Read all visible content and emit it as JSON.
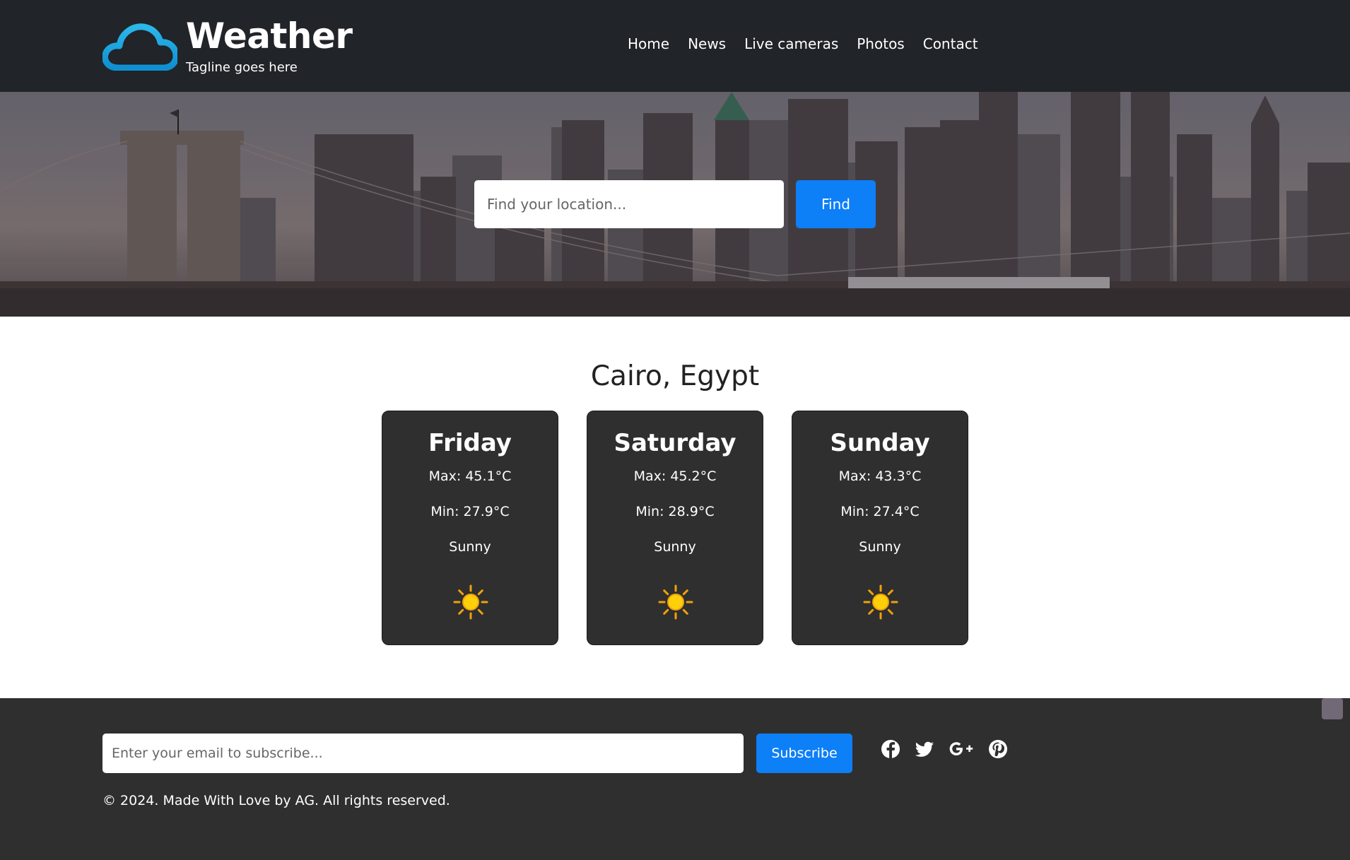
{
  "header": {
    "title": "Weather",
    "tagline": "Tagline goes here",
    "nav": [
      {
        "label": "Home"
      },
      {
        "label": "News"
      },
      {
        "label": "Live cameras"
      },
      {
        "label": "Photos"
      },
      {
        "label": "Contact"
      }
    ]
  },
  "hero": {
    "search_placeholder": "Find your location...",
    "find_label": "Find"
  },
  "forecast": {
    "location": "Cairo, Egypt",
    "days": [
      {
        "day": "Friday",
        "max": "Max: 45.1°C",
        "min": "Min: 27.9°C",
        "condition": "Sunny",
        "icon": "sun-icon"
      },
      {
        "day": "Saturday",
        "max": "Max: 45.2°C",
        "min": "Min: 28.9°C",
        "condition": "Sunny",
        "icon": "sun-icon"
      },
      {
        "day": "Sunday",
        "max": "Max: 43.3°C",
        "min": "Min: 27.4°C",
        "condition": "Sunny",
        "icon": "sun-icon"
      }
    ]
  },
  "footer": {
    "email_placeholder": "Enter your email to subscribe...",
    "subscribe_label": "Subscribe",
    "socials": [
      "facebook-icon",
      "twitter-icon",
      "google-plus-icon",
      "pinterest-icon"
    ],
    "copyright": "© 2024. Made With Love by AG. All rights reserved."
  },
  "colors": {
    "header_bg": "#212429",
    "accent": "#0d7ff7",
    "card_bg": "#2f2f2f",
    "footer_bg": "#2f2f2f",
    "logo": "#1ea7e0"
  }
}
